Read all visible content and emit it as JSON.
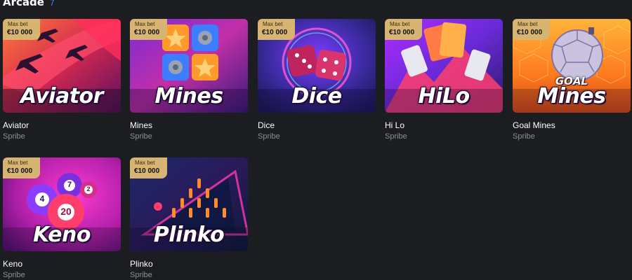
{
  "section": {
    "title": "Arcade",
    "count": "7"
  },
  "games": [
    {
      "title_art": "Aviator",
      "name": "Aviator",
      "provider": "Spribe",
      "badge_label": "Max bet",
      "badge_value": "€10 000"
    },
    {
      "title_art": "Mines",
      "name": "Mines",
      "provider": "Spribe",
      "badge_label": "Max bet",
      "badge_value": "€10 000"
    },
    {
      "title_art": "Dice",
      "name": "Dice",
      "provider": "Spribe",
      "badge_label": "Max bet",
      "badge_value": "€10 000"
    },
    {
      "title_art": "HiLo",
      "name": "Hi Lo",
      "provider": "Spribe",
      "badge_label": "Max bet",
      "badge_value": "€10 000"
    },
    {
      "title_art": "Mines",
      "title_art_top": "GOAL",
      "name": "Goal Mines",
      "provider": "Spribe",
      "badge_label": "Max bet",
      "badge_value": "€10 000"
    },
    {
      "title_art": "Keno",
      "name": "Keno",
      "provider": "Spribe",
      "badge_label": "Max bet",
      "badge_value": "€10 000"
    },
    {
      "title_art": "Plinko",
      "name": "Plinko",
      "provider": "Spribe",
      "badge_label": "Max bet",
      "badge_value": "€10 000"
    }
  ],
  "keno_balls": [
    "4",
    "7",
    "2",
    "20"
  ],
  "colors": {
    "background": "#1b1d21",
    "badge": "#d7b471",
    "count_accent": "#3a8bff",
    "provider_text": "#8b8f97"
  }
}
